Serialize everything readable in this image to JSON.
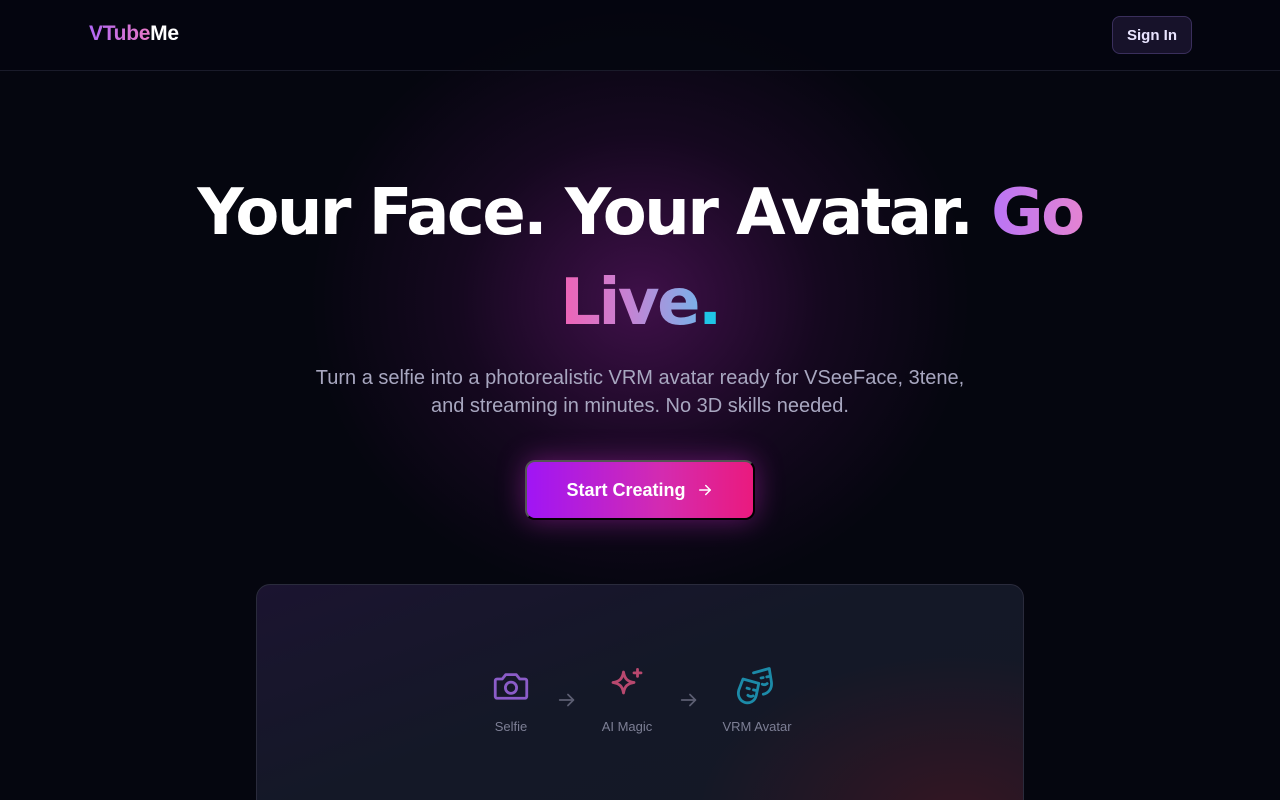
{
  "header": {
    "logo_part1": "VTube",
    "logo_part2": "Me",
    "signin_label": "Sign In"
  },
  "hero": {
    "headline_white1": "Your Face. Your Avatar. ",
    "headline_go": "Go",
    "headline_live": "Live",
    "headline_dot": ".",
    "subtitle": "Turn a selfie into a photorealistic VRM avatar ready for VSeeFace, 3tene, and streaming in minutes. No 3D skills needed.",
    "cta_label": "Start Creating"
  },
  "steps": [
    {
      "label": "Selfie",
      "icon": "camera-icon"
    },
    {
      "label": "AI Magic",
      "icon": "sparkles-icon"
    },
    {
      "label": "VRM Avatar",
      "icon": "theater-mask-icon"
    }
  ],
  "colors": {
    "background": "#05060f",
    "accent_purple": "#a015f5",
    "accent_pink": "#ea1a7e",
    "selfie_icon": "#8b5cc8",
    "ai_icon": "#b8486e",
    "vrm_icon": "#1c8aa8"
  }
}
